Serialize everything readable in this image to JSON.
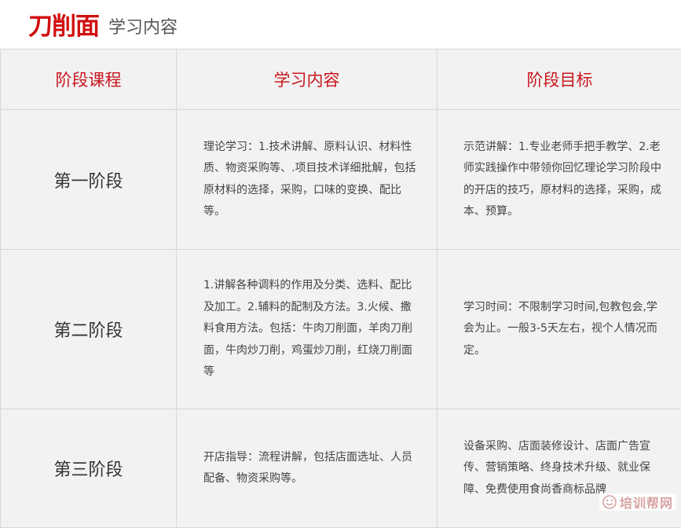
{
  "header": {
    "title": "刀削面",
    "subtitle": "学习内容"
  },
  "table": {
    "headers": [
      "阶段课程",
      "学习内容",
      "阶段目标"
    ],
    "rows": [
      {
        "stage": "第一阶段",
        "content": "理论学习：1.技术讲解、原料认识、材料性质、物资采购等、.项目技术详细批解，包括原材料的选择，采购，口味的变换、配比等。",
        "goal": "示范讲解：1.专业老师手把手教学、2.老师实践操作中带领你回忆理论学习阶段中的开店的技巧，原材料的选择，采购，成本、预算。"
      },
      {
        "stage": "第二阶段",
        "content": "1.讲解各种调料的作用及分类、选料、配比及加工。2.辅料的配制及方法。3.火候、撒料食用方法。包括：牛肉刀削面，羊肉刀削面，牛肉炒刀削，鸡蛋炒刀削，红烧刀削面等",
        "goal": "学习时间：不限制学习时间,包教包会,学会为止。一般3-5天左右，视个人情况而定。"
      },
      {
        "stage": "第三阶段",
        "content": "开店指导：流程讲解，包括店面选址、人员配备、物资采购等。",
        "goal": "设备采购、店面装修设计、店面广告宣传、营销策略、终身技术升级、就业保障、免费使用食尚香商标品牌"
      }
    ]
  },
  "watermark": {
    "text": "培训帮网",
    "icon": "smiley-icon"
  }
}
